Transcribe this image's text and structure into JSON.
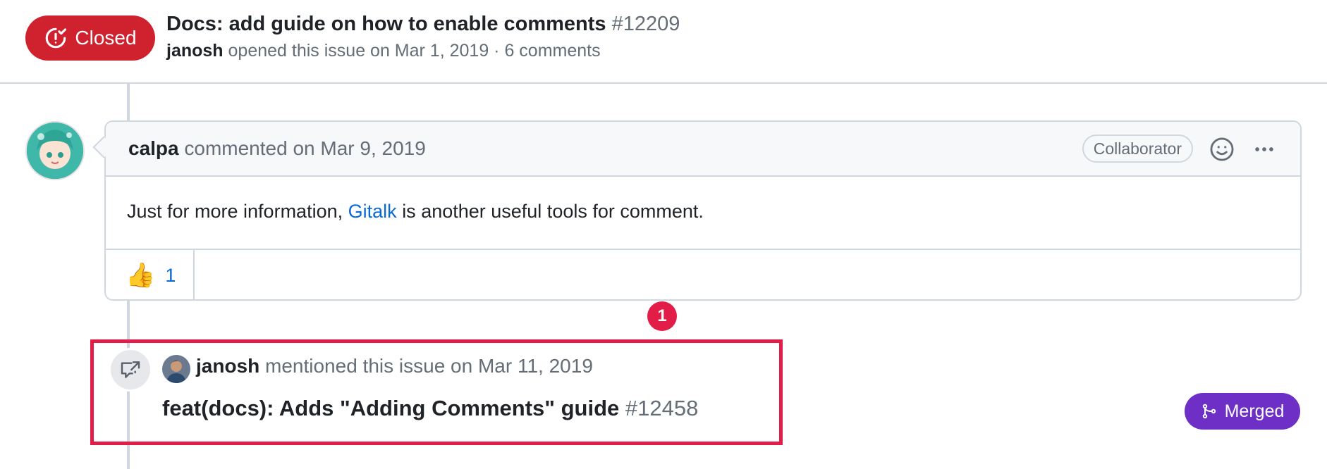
{
  "issue": {
    "state": "Closed",
    "title": "Docs: add guide on how to enable comments",
    "number": "#12209",
    "author": "janosh",
    "opened_text": "opened this issue on Mar 1, 2019 · 6 comments"
  },
  "comment": {
    "author": "calpa",
    "action_text": "commented on Mar 9, 2019",
    "role": "Collaborator",
    "body_before": "Just for more information,",
    "link_text": "Gitalk",
    "body_after": "is another useful tools for comment.",
    "reaction_emoji": "👍",
    "reaction_count": "1"
  },
  "marker": {
    "label": "1"
  },
  "event": {
    "author": "janosh",
    "action_text": "mentioned this issue on Mar 11, 2019",
    "pr_title": "feat(docs): Adds \"Adding Comments\" guide",
    "pr_number": "#12458",
    "pr_state": "Merged"
  },
  "colors": {
    "closed": "#cf222e",
    "merged": "#6d2fc5",
    "link": "#0969da",
    "annotation": "#e11d48"
  }
}
